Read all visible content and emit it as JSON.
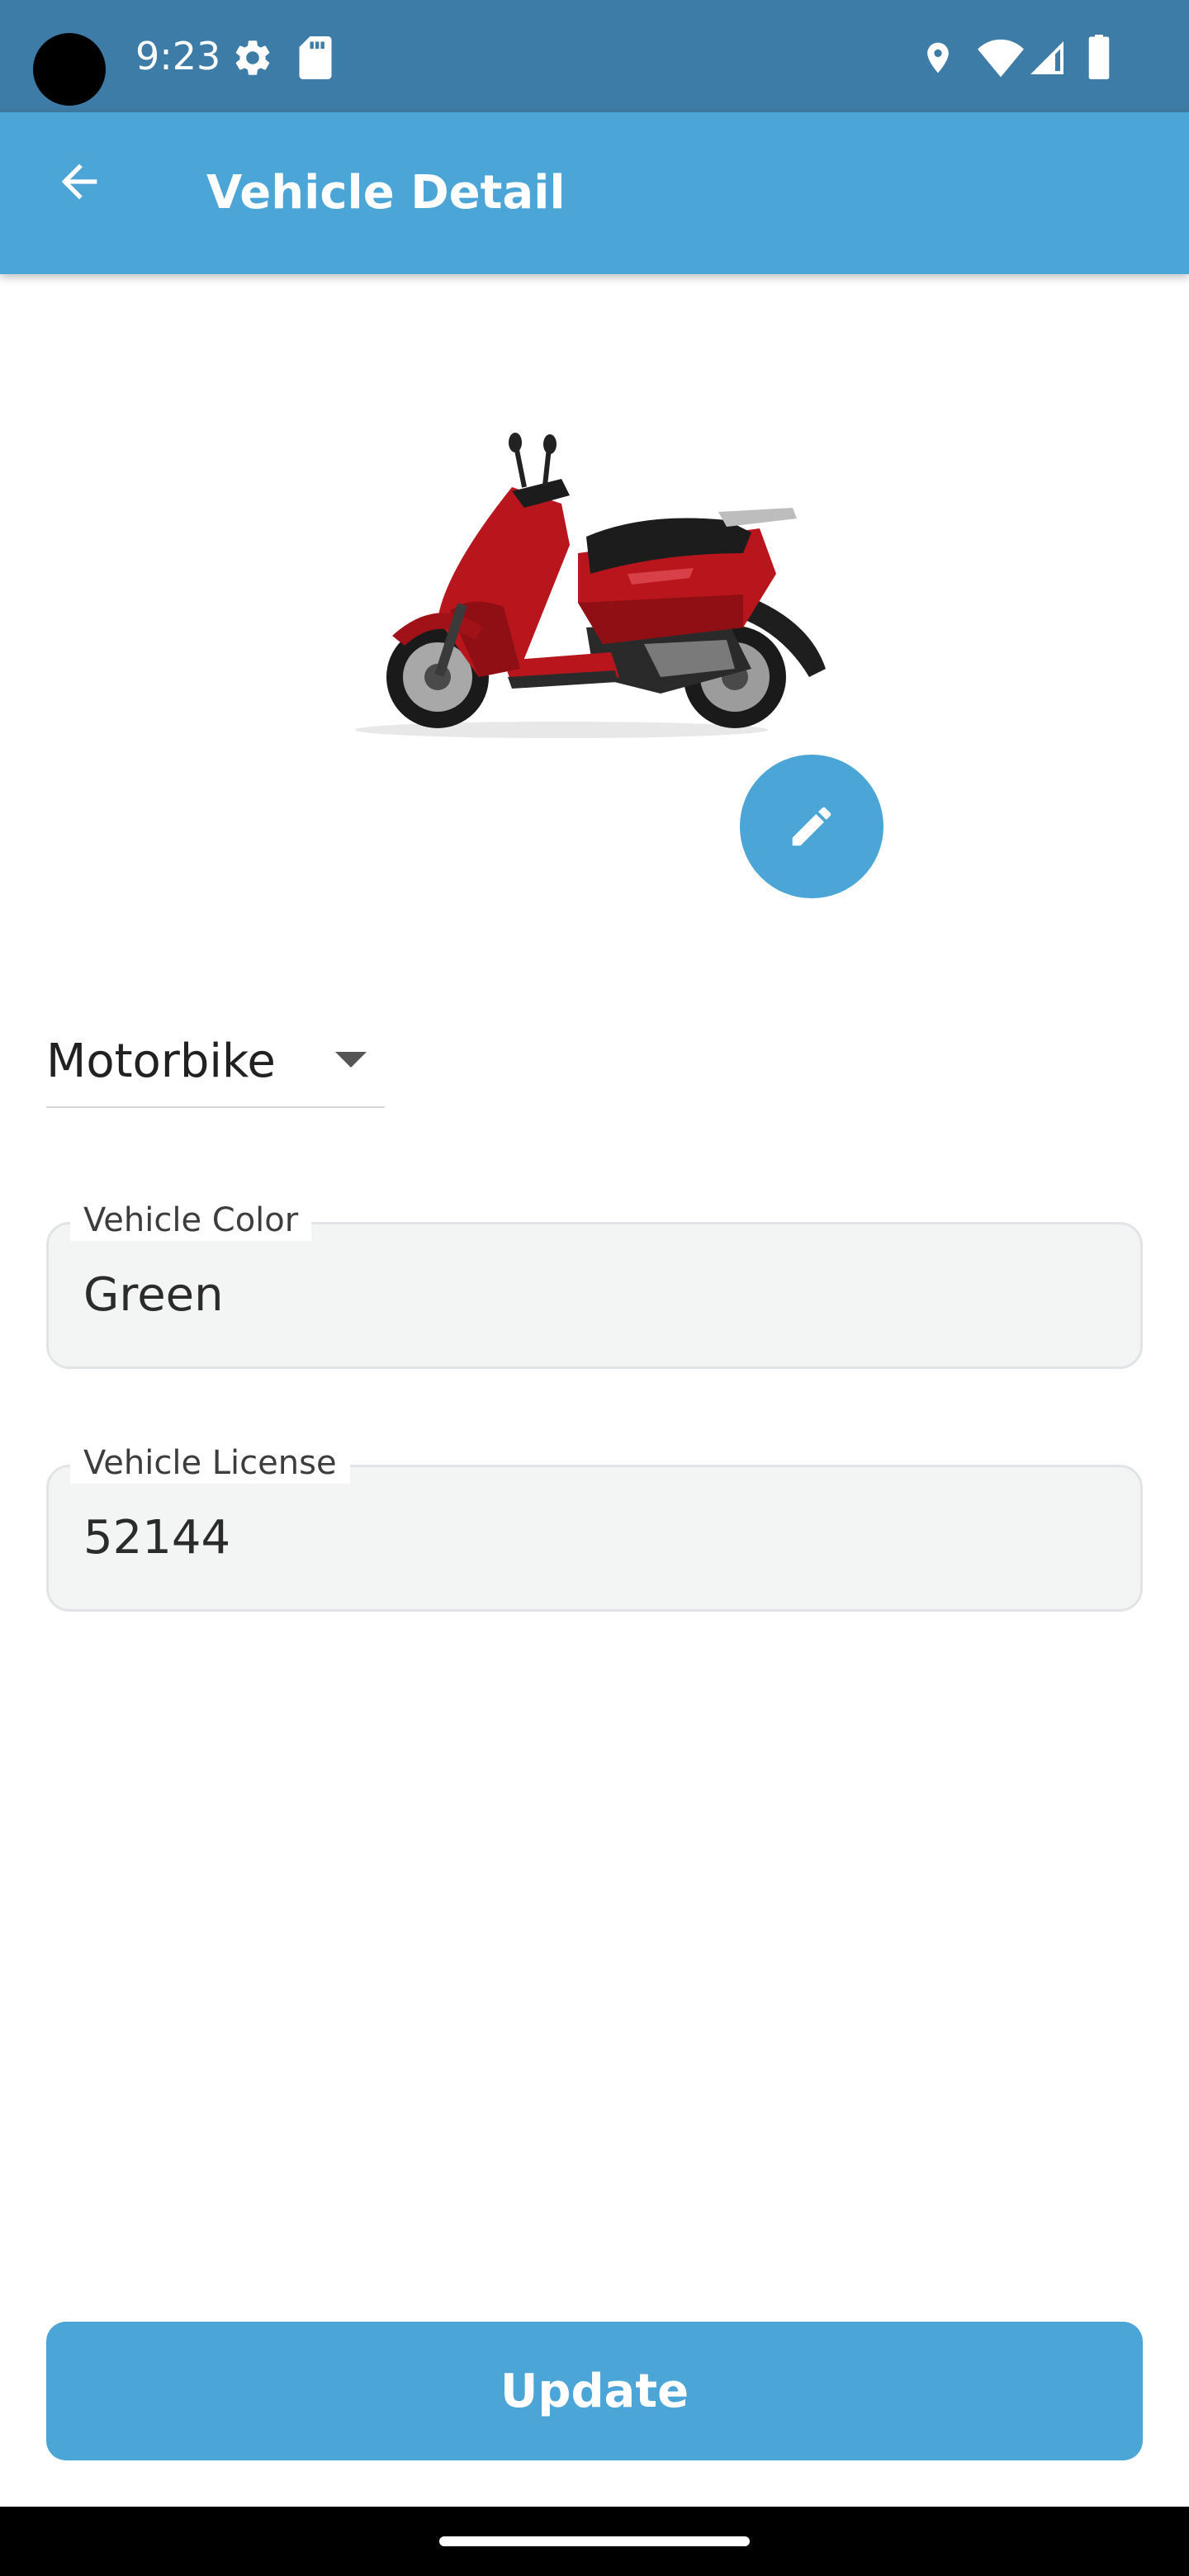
{
  "status_bar": {
    "time": "9:23",
    "left_icons": [
      "settings-icon",
      "sd-card-icon"
    ],
    "right_icons": [
      "location-icon",
      "wifi-icon",
      "signal-icon",
      "battery-icon"
    ]
  },
  "app_bar": {
    "title": "Vehicle Detail",
    "back_icon": "arrow-back-icon"
  },
  "vehicle": {
    "image": "red-scooter-photo",
    "edit_icon": "pencil-icon",
    "type": "Motorbike",
    "color_field": {
      "label": "Vehicle Color",
      "value": "Green"
    },
    "license_field": {
      "label": "Vehicle License",
      "value": "52144"
    }
  },
  "actions": {
    "update_label": "Update"
  },
  "colors": {
    "status_bar": "#3d7ca6",
    "primary": "#4ba5d6",
    "field_bg": "#f3f4f4"
  }
}
